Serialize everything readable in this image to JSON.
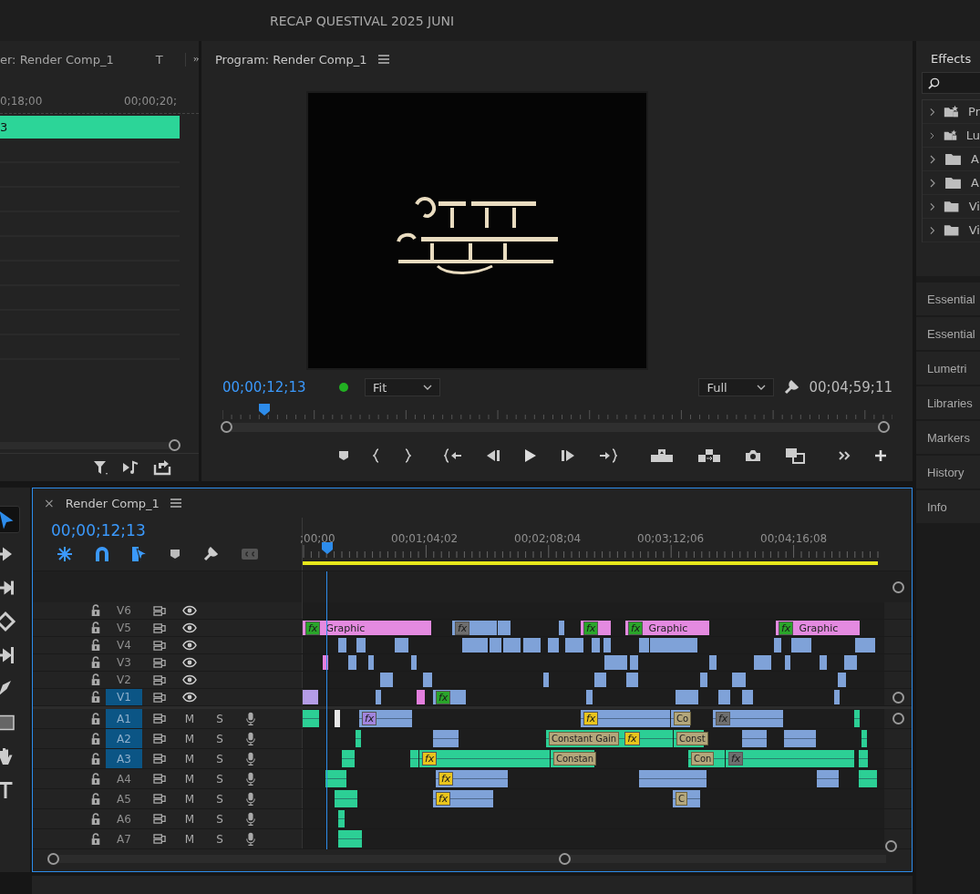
{
  "title": "RECAP QUESTIVAL 2025 JUNI",
  "left_panel": {
    "tab": "er: Render Comp_1",
    "tab_2": "T",
    "ruler": [
      "0;18;00",
      "00;00;20;"
    ],
    "clip_label": "3"
  },
  "program": {
    "title": "Program: Render Comp_1",
    "timecode": "00;00;12;13",
    "zoom": "Fit",
    "resolution": "Full",
    "duration": "00;04;59;11",
    "playhead": {
      "level": 0.03
    }
  },
  "effects": {
    "tab": "Effects",
    "items": [
      {
        "label": "Pr",
        "kind": "preset"
      },
      {
        "label": "Lu",
        "kind": "preset"
      },
      {
        "label": "A",
        "kind": "folder"
      },
      {
        "label": "A",
        "kind": "folder"
      },
      {
        "label": "Vi",
        "kind": "folder"
      },
      {
        "label": "Vi",
        "kind": "folder"
      }
    ]
  },
  "panels": [
    "Essential",
    "Essential",
    "Lumetri",
    "Libraries",
    "Markers",
    "History",
    "Info"
  ],
  "tools": [
    {
      "kind": "selection",
      "selected": true
    },
    {
      "kind": "track-select",
      "selected": false
    },
    {
      "kind": "ripple",
      "selected": false
    },
    {
      "kind": "razor",
      "selected": false
    },
    {
      "kind": "slip",
      "selected": false
    },
    {
      "kind": "pen",
      "selected": false
    },
    {
      "kind": "rectangle",
      "selected": false
    },
    {
      "kind": "hand",
      "selected": false
    },
    {
      "kind": "type",
      "selected": false
    }
  ],
  "timeline": {
    "close": "×",
    "title": "Render Comp_1",
    "timecode": "00;00;12;13",
    "ruler": [
      ";00;00",
      "00;01;04;02",
      "00;02;08;04",
      "00;03;12;06",
      "00;04;16;08"
    ],
    "playhead": {
      "level": 0.04
    },
    "tracks": [
      {
        "name": "V6",
        "kind": "video",
        "targeted": false
      },
      {
        "name": "V5",
        "kind": "video",
        "targeted": false,
        "clips": [
          {
            "kind": "graphic",
            "label": "Graphic",
            "fx": {
              "text": "fx",
              "color": "#2aa52a"
            }
          },
          {
            "kind": "video",
            "fx": {
              "text": "fx",
              "color": "#6e6e6e"
            }
          },
          {
            "kind": "video"
          },
          {
            "kind": "video"
          },
          {
            "kind": "graphic",
            "fx": {
              "text": "fx",
              "color": "#2aa52a"
            }
          },
          {
            "kind": "graphic",
            "label": "Graphic",
            "fx": {
              "text": "fx",
              "color": "#2aa52a"
            }
          },
          {
            "kind": "graphic",
            "label": "Graphic",
            "fx": {
              "text": "fx",
              "color": "#2aa52a"
            }
          }
        ]
      },
      {
        "name": "V4",
        "kind": "video",
        "targeted": false,
        "clips": [
          {
            "kind": "video"
          },
          {
            "kind": "video"
          },
          {
            "kind": "video"
          },
          {
            "kind": "video"
          },
          {
            "kind": "video"
          },
          {
            "kind": "video"
          },
          {
            "kind": "video"
          },
          {
            "kind": "video"
          },
          {
            "kind": "video"
          },
          {
            "kind": "video"
          },
          {
            "kind": "video"
          },
          {
            "kind": "video"
          },
          {
            "kind": "video"
          },
          {
            "kind": "video"
          },
          {
            "kind": "video"
          },
          {
            "kind": "video"
          }
        ]
      },
      {
        "name": "V3",
        "kind": "video",
        "targeted": false,
        "clips": [
          {
            "kind": "pink"
          },
          {
            "kind": "video"
          },
          {
            "kind": "video"
          },
          {
            "kind": "video"
          },
          {
            "kind": "video"
          },
          {
            "kind": "video"
          },
          {
            "kind": "video"
          },
          {
            "kind": "video"
          },
          {
            "kind": "video"
          },
          {
            "kind": "video"
          },
          {
            "kind": "video"
          }
        ]
      },
      {
        "name": "V2",
        "kind": "video",
        "targeted": false,
        "clips": [
          {
            "kind": "video"
          },
          {
            "kind": "video"
          },
          {
            "kind": "video"
          },
          {
            "kind": "video"
          },
          {
            "kind": "video"
          },
          {
            "kind": "video"
          },
          {
            "kind": "video"
          },
          {
            "kind": "video"
          }
        ]
      },
      {
        "name": "V1",
        "kind": "video",
        "targeted": true,
        "clips": [
          {
            "kind": "purple"
          },
          {
            "kind": "video"
          },
          {
            "kind": "pink"
          },
          {
            "kind": "video",
            "fx": {
              "text": "fx",
              "color": "#2aa52a"
            }
          },
          {
            "kind": "video"
          },
          {
            "kind": "video"
          },
          {
            "kind": "video"
          },
          {
            "kind": "video"
          },
          {
            "kind": "video"
          }
        ]
      },
      {
        "name": "A1",
        "kind": "audio",
        "targeted": true,
        "mute": "M",
        "solo": "S",
        "clips": [
          {
            "kind": "audio-green"
          },
          {
            "kind": "white"
          },
          {
            "kind": "audio",
            "fx": {
              "text": "fx",
              "color": "#a184dd"
            }
          },
          {
            "kind": "audio",
            "fx": {
              "text": "fx",
              "color": "#e9c41c"
            }
          },
          {
            "kind": "audio",
            "label": "Co"
          },
          {
            "kind": "audio",
            "fx": {
              "text": "fx",
              "color": "#6e6e6e"
            }
          },
          {
            "kind": "audio-green"
          }
        ]
      },
      {
        "name": "A2",
        "kind": "audio",
        "targeted": true,
        "mute": "M",
        "solo": "S",
        "clips": [
          {
            "kind": "audio-green"
          },
          {
            "kind": "audio"
          },
          {
            "kind": "audio-green",
            "label": "Constant Gain",
            "fx": {
              "text": "fx",
              "color": "#e9c41c"
            }
          },
          {
            "kind": "audio-green",
            "label": "Const"
          },
          {
            "kind": "audio"
          },
          {
            "kind": "audio"
          },
          {
            "kind": "audio-green"
          }
        ]
      },
      {
        "name": "A3",
        "kind": "audio",
        "targeted": true,
        "mute": "M",
        "solo": "S",
        "clips": [
          {
            "kind": "audio-green"
          },
          {
            "kind": "audio-green"
          },
          {
            "kind": "audio-green",
            "fx": {
              "text": "fx",
              "color": "#e9c41c"
            }
          },
          {
            "kind": "audio-green",
            "label": "Constan"
          },
          {
            "kind": "audio-green",
            "label": "Con"
          },
          {
            "kind": "audio-green",
            "fx": {
              "text": "fx",
              "color": "#6e6e6e"
            }
          },
          {
            "kind": "audio-green"
          }
        ]
      },
      {
        "name": "A4",
        "kind": "audio",
        "targeted": false,
        "mute": "M",
        "solo": "S",
        "clips": [
          {
            "kind": "audio-green"
          },
          {
            "kind": "audio",
            "fx": {
              "text": "fx",
              "color": "#e9c41c"
            }
          },
          {
            "kind": "audio"
          },
          {
            "kind": "audio"
          },
          {
            "kind": "audio-green"
          }
        ]
      },
      {
        "name": "A5",
        "kind": "audio",
        "targeted": false,
        "mute": "M",
        "solo": "S",
        "clips": [
          {
            "kind": "audio-green"
          },
          {
            "kind": "audio",
            "fx": {
              "text": "fx",
              "color": "#e9c41c"
            }
          },
          {
            "kind": "audio",
            "label": "C"
          }
        ]
      },
      {
        "name": "A6",
        "kind": "audio",
        "targeted": false,
        "mute": "M",
        "solo": "S",
        "clips": [
          {
            "kind": "audio-green"
          }
        ]
      },
      {
        "name": "A7",
        "kind": "audio",
        "targeted": false,
        "mute": "M",
        "solo": "S",
        "clips": [
          {
            "kind": "audio-green"
          }
        ]
      }
    ]
  }
}
